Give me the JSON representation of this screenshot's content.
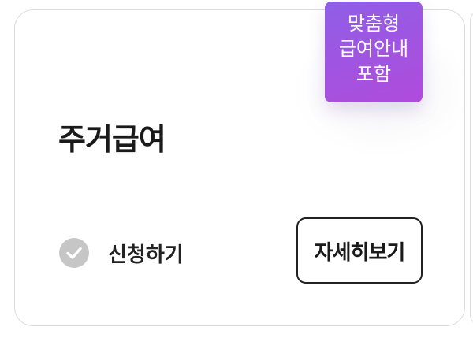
{
  "badge": {
    "lines": [
      "맞춤형",
      "급여안내",
      "포함"
    ]
  },
  "card": {
    "title": "주거급여",
    "apply_label": "신청하기",
    "detail_button": "자세히보기"
  },
  "icons": {
    "apply_status": "check-circle-icon"
  },
  "colors": {
    "badge_gradient_start": "#8f5fe6",
    "badge_gradient_end": "#b04bdc",
    "check_circle": "#c6c6c6",
    "title_text": "#1a1a1a",
    "card_border": "#dcdcdc"
  }
}
